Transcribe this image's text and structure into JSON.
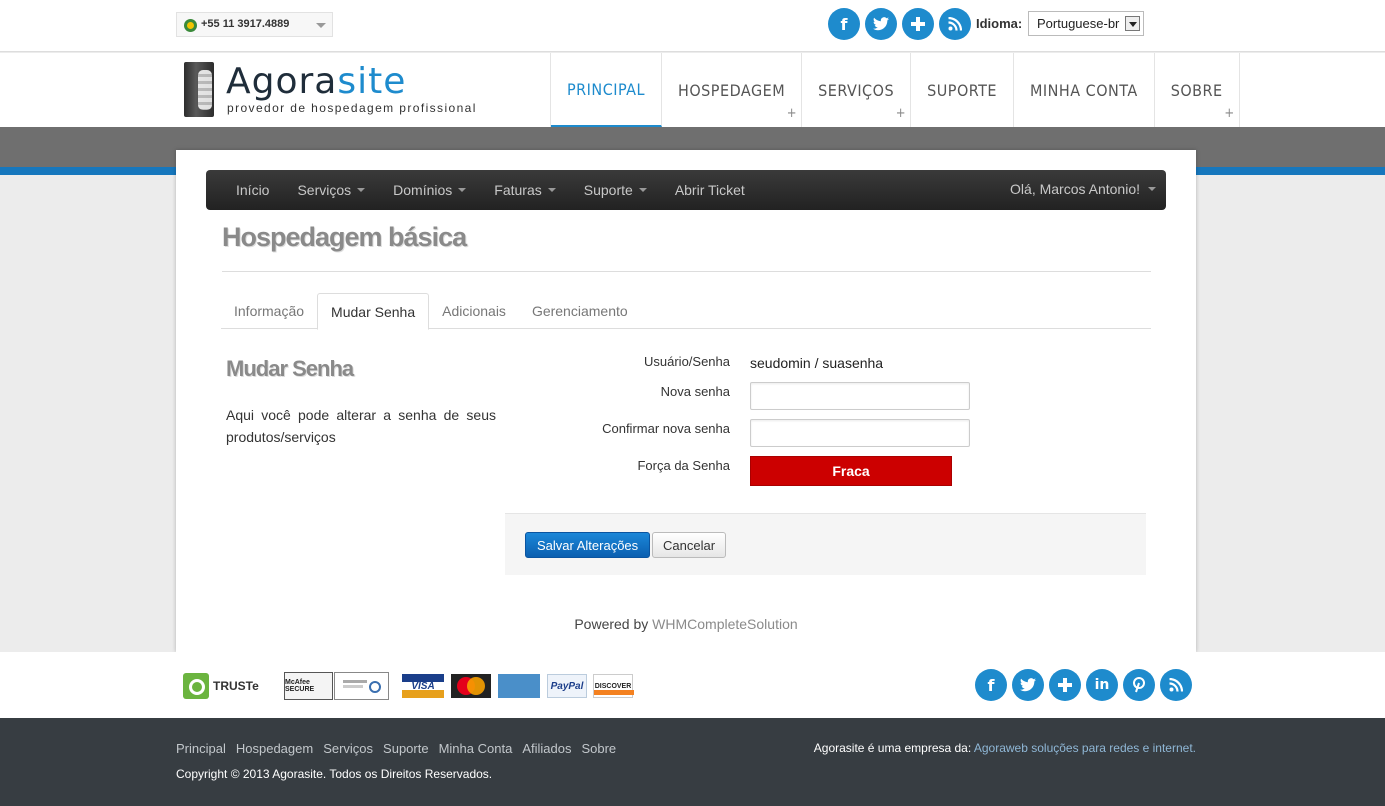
{
  "topbar": {
    "phone": "+55 11 3917.4889",
    "social": [
      "f",
      "t",
      "+",
      "rss"
    ],
    "language_label": "Idioma:",
    "language_value": "Portuguese-br"
  },
  "header": {
    "logo_main": "Agora",
    "logo_accent": "site",
    "logo_sub": "provedor de hospedagem profissional",
    "nav": [
      {
        "label": "PRINCIPAL",
        "active": true,
        "plus": false
      },
      {
        "label": "HOSPEDAGEM",
        "active": false,
        "plus": true
      },
      {
        "label": "SERVIÇOS",
        "active": false,
        "plus": true
      },
      {
        "label": "SUPORTE",
        "active": false,
        "plus": false
      },
      {
        "label": "MINHA CONTA",
        "active": false,
        "plus": false
      },
      {
        "label": "SOBRE",
        "active": false,
        "plus": true
      }
    ]
  },
  "clientnav": {
    "items": [
      "Início",
      "Serviços",
      "Domínios",
      "Faturas",
      "Suporte",
      "Abrir Ticket"
    ],
    "user": "Olá, Marcos Antonio!"
  },
  "page": {
    "title": "Hospedagem básica",
    "tabs": [
      "Informação",
      "Mudar Senha",
      "Adicionais",
      "Gerenciamento"
    ],
    "active_tab": "Mudar Senha",
    "side_title": "Mudar Senha",
    "side_desc": "Aqui você pode alterar a senha de seus produtos/serviços"
  },
  "form": {
    "user_label": "Usuário/Senha",
    "user_value": "seudomin / suasenha",
    "new_label": "Nova senha",
    "new_value": "",
    "confirm_label": "Confirmar nova senha",
    "confirm_value": "",
    "strength_label": "Força da Senha",
    "strength_value": "Fraca",
    "save": "Salvar Alterações",
    "cancel": "Cancelar"
  },
  "powered": {
    "prefix": "Powered by",
    "link": "WHMCompleteSolution"
  },
  "badges": {
    "truste": "TRUSTe",
    "mcafee": "McAfee SECURE",
    "visa": "VISA",
    "paypal": "PayPal",
    "discover": "DISCOVER"
  },
  "footer": {
    "links": [
      "Principal",
      "Hospedagem",
      "Serviços",
      "Suporte",
      "Minha Conta",
      "Afiliados",
      "Sobre"
    ],
    "copyright": "Copyright © 2013 Agorasite. Todos os Direitos Reservados.",
    "company_prefix": "Agorasite é uma empresa da:",
    "company_link": "Agoraweb soluções para redes e internet."
  },
  "colors": {
    "accent": "#1e8bcd",
    "strength_weak": "#cc0000",
    "footer_bg": "#373d42"
  }
}
